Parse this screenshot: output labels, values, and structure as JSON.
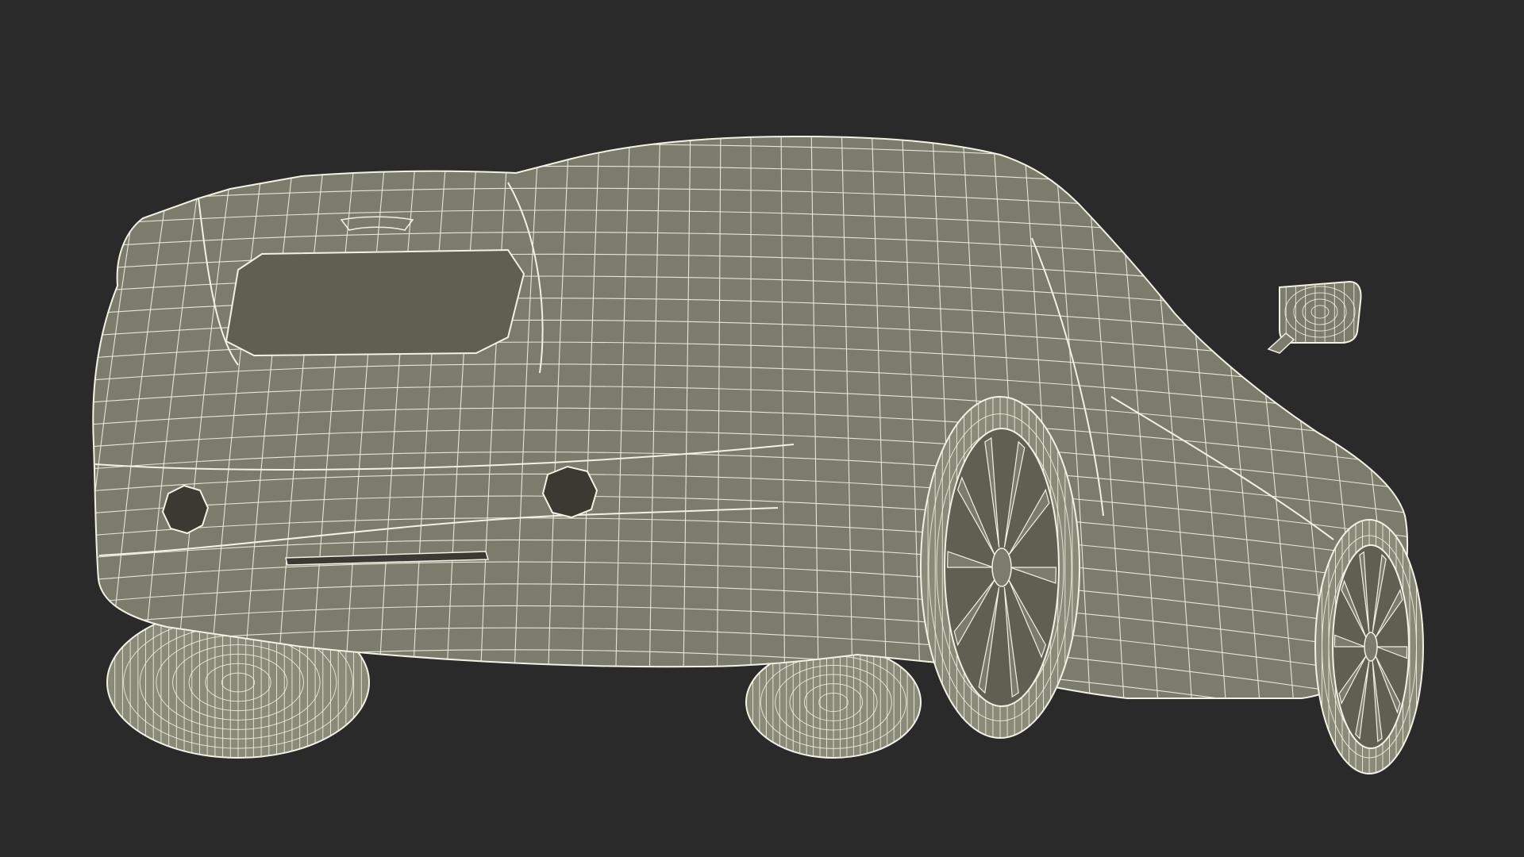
{
  "render": {
    "background_color": "#2a2a2a",
    "body_color": "#7c7c6c",
    "body_shade_color": "#5f5f52",
    "wire_color": "#f2f2e4",
    "tire_color": "#8a8a79",
    "dark_opening_color": "#3a3a33"
  }
}
